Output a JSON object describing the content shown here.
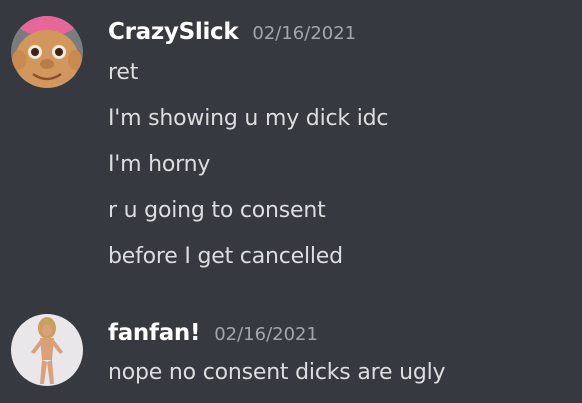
{
  "theme": {
    "background": "#36393f",
    "username_color": "#ffffff",
    "timestamp_color": "#a3a6aa",
    "text_color": "#dcddde"
  },
  "messages": [
    {
      "username": "CrazySlick",
      "timestamp": "02/16/2021",
      "avatar_icon": "troll-doll-avatar",
      "lines": [
        "ret",
        "I'm showing u my dick idc",
        "I'm horny",
        "r u going to consent",
        "before I get cancelled"
      ]
    },
    {
      "username": "fanfan!",
      "timestamp": "02/16/2021",
      "avatar_icon": "doll-figure-avatar",
      "lines": [
        "nope no consent dicks are ugly"
      ]
    }
  ]
}
